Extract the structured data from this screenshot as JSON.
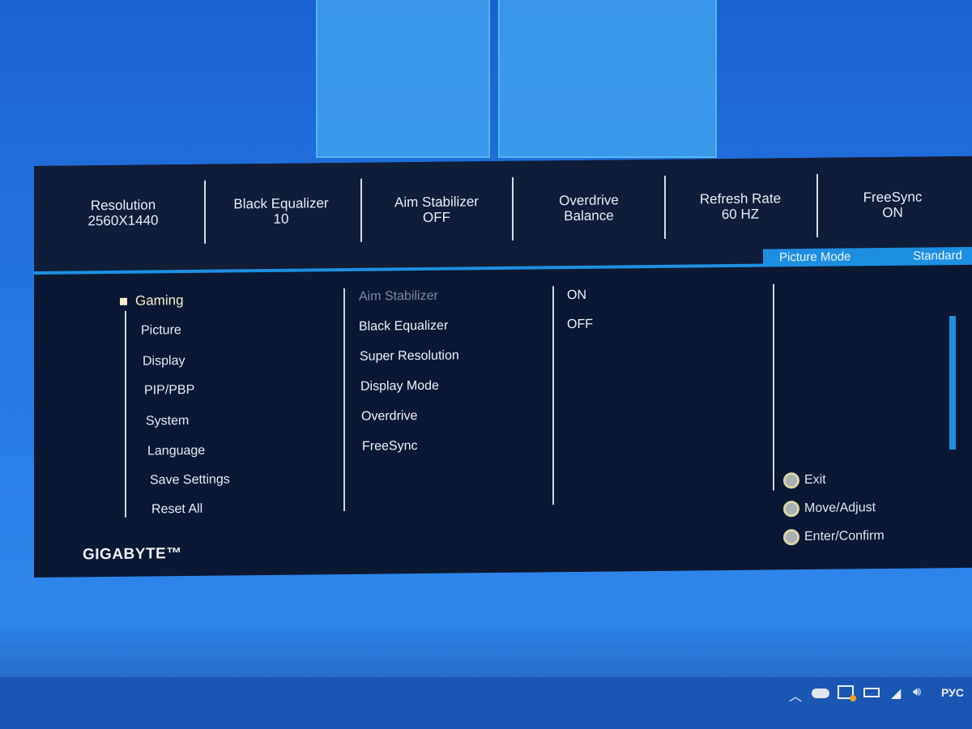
{
  "status_bar": [
    {
      "label": "Resolution",
      "value": "2560X1440"
    },
    {
      "label": "Black Equalizer",
      "value": "10"
    },
    {
      "label": "Aim Stabilizer",
      "value": "OFF"
    },
    {
      "label": "Overdrive",
      "value": "Balance"
    },
    {
      "label": "Refresh Rate",
      "value": "60 HZ"
    },
    {
      "label": "FreeSync",
      "value": "ON"
    }
  ],
  "picture_mode": {
    "label": "Picture Mode",
    "value": "Standard"
  },
  "main_menu": [
    "Gaming",
    "Picture",
    "Display",
    "PIP/PBP",
    "System",
    "Language",
    "Save Settings",
    "Reset All"
  ],
  "selected_menu": "Gaming",
  "submenu": [
    "Aim Stabilizer",
    "Black Equalizer",
    "Super Resolution",
    "Display Mode",
    "Overdrive",
    "FreeSync"
  ],
  "options": [
    "ON",
    "OFF"
  ],
  "hints": [
    "Exit",
    "Move/Adjust",
    "Enter/Confirm"
  ],
  "brand": "GIGABYTE™",
  "tray": {
    "language": "РУС",
    "icons": [
      "chevron-up-icon",
      "cloud-icon",
      "display-alert-icon",
      "battery-plug-icon",
      "wifi-icon",
      "volume-icon"
    ]
  },
  "colors": {
    "accent": "#1e8fe0",
    "panel": "#0b1833",
    "desktop": "#2a7ee6"
  }
}
